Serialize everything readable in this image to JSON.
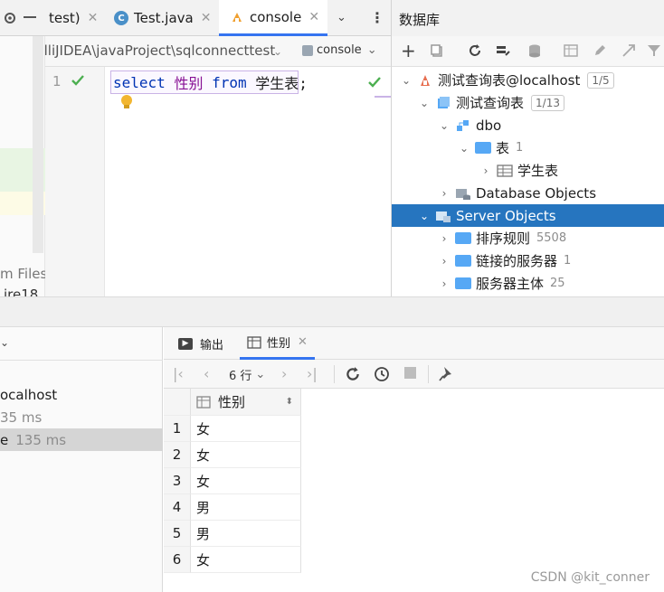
{
  "editor_tabs": {
    "partial_label": "test)",
    "file_tab_label": "Test.java",
    "console_tab_label": "console",
    "path_text": "VAIntelliJIDEA\\javaProject\\sqlconnecttest",
    "console_dropdown_label": "console"
  },
  "project_strip": {
    "files_text": "m Files\\",
    "jre_text": "jre18"
  },
  "editor": {
    "line_number": "1",
    "code": {
      "kw_select": "select",
      "column": "性别",
      "kw_from": "from",
      "table": "学生表;"
    }
  },
  "db_panel": {
    "title": "数据库",
    "tree": [
      {
        "label": "测试查询表@localhost",
        "badge": "1/5"
      },
      {
        "label": "测试查询表",
        "badge": "1/13"
      },
      {
        "label": "dbo"
      },
      {
        "label": "表",
        "count": "1"
      },
      {
        "label": "学生表"
      },
      {
        "label": "Database Objects"
      },
      {
        "label": "Server Objects"
      },
      {
        "label": "排序规则",
        "count": "5508"
      },
      {
        "label": "链接的服务器",
        "count": "1"
      },
      {
        "label": "服务器主体",
        "count": "25"
      }
    ]
  },
  "services": {
    "items": [
      {
        "label": "ocalhost"
      },
      {
        "label": "35 ms"
      },
      {
        "label": "e",
        "time": "135 ms"
      }
    ]
  },
  "results": {
    "tab_output": "输出",
    "tab_table": "性别",
    "row_count": "6 行",
    "column_header": "性别",
    "rows": [
      {
        "n": "1",
        "v": "女"
      },
      {
        "n": "2",
        "v": "女"
      },
      {
        "n": "3",
        "v": "女"
      },
      {
        "n": "4",
        "v": "男"
      },
      {
        "n": "5",
        "v": "男"
      },
      {
        "n": "6",
        "v": "女"
      }
    ]
  },
  "watermark": "CSDN @kit_conner",
  "colors": {
    "selection": "#2675bf",
    "tab_underline": "#3574f0",
    "keyword": "#0033b3",
    "column": "#871094",
    "check": "#4caf50"
  }
}
